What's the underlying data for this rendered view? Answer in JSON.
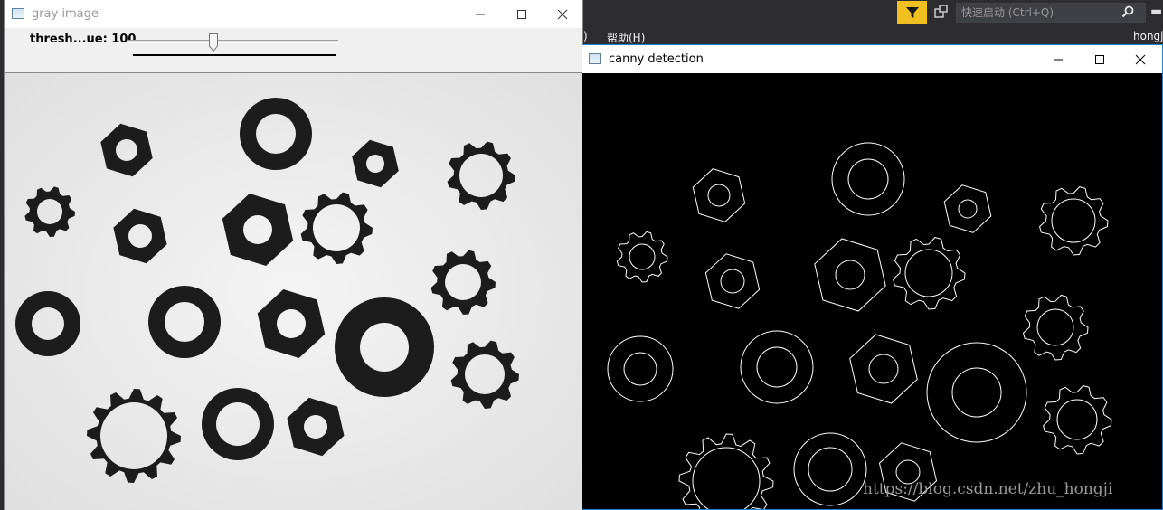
{
  "ide": {
    "search_placeholder": "快速启动 (Ctrl+Q)",
    "menu_fragment": ")",
    "menu_help": "帮助(H)",
    "user_fragment": "hongj"
  },
  "gray_window": {
    "title": "gray image",
    "trackbar_label": "thresh...ue: 100",
    "trackbar_value": 100
  },
  "canny_window": {
    "title": "canny detection"
  },
  "watermark": "https://blog.csdn.net/zhu_hongji",
  "colors": {
    "filter_button": "#f0c020",
    "canny_border": "#1883d7",
    "background_gray": "#e9e9e9",
    "part_dark": "#1c1c1c"
  },
  "icons": [
    "filter-icon",
    "share-icon",
    "search-icon",
    "minimize-icon",
    "maximize-icon",
    "close-icon",
    "app-icon"
  ]
}
